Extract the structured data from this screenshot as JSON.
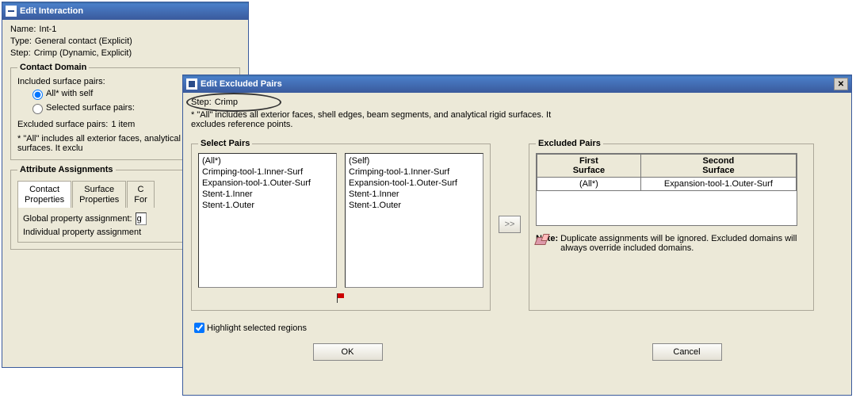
{
  "w1": {
    "title": "Edit Interaction",
    "nameLbl": "Name:",
    "nameVal": "Int-1",
    "typeLbl": "Type:",
    "typeVal": "General contact (Explicit)",
    "stepLbl": "Step:",
    "stepVal": "Crimp (Dynamic, Explicit)",
    "domainLegend": "Contact Domain",
    "includedLbl": "Included surface pairs:",
    "radioAll": "All* with self",
    "radioSel": "Selected surface pairs:",
    "excludedLbl": "Excluded surface pairs:",
    "excludedVal": "1 item",
    "note": "* \"All\" includes all exterior faces, analytical rigid surfaces. It exclu",
    "attrLegend": "Attribute Assignments",
    "tab1a": "Contact",
    "tab1b": "Properties",
    "tab2a": "Surface",
    "tab2b": "Properties",
    "tab3a": "C",
    "tab3b": "For",
    "globLbl": "Global property assignment:",
    "globVal": "g",
    "indivLbl": "Individual property assignment"
  },
  "w2": {
    "title": "Edit Excluded Pairs",
    "stepLbl": "Step:",
    "stepVal": "Crimp",
    "note": "* \"All\" includes all exterior faces, shell edges, beam segments, and analytical rigid surfaces. It excludes reference points.",
    "selLegend": "Select Pairs",
    "list1": [
      "(All*)",
      "Crimping-tool-1.Inner-Surf",
      "Expansion-tool-1.Outer-Surf",
      "Stent-1.Inner",
      "Stent-1.Outer"
    ],
    "list2": [
      "(Self)",
      "Crimping-tool-1.Inner-Surf",
      "Expansion-tool-1.Outer-Surf",
      "Stent-1.Inner",
      "Stent-1.Outer"
    ],
    "arrow": ">>",
    "exclLegend": "Excluded Pairs",
    "th1a": "First",
    "th1b": "Surface",
    "th2a": "Second",
    "th2b": "Surface",
    "td1": "(All*)",
    "td2": "Expansion-tool-1.Outer-Surf",
    "noteLbl": "Note:",
    "noteTxt": "Duplicate assignments will be ignored. Excluded domains will always override included domains.",
    "highlight": "Highlight selected regions",
    "ok": "OK",
    "cancel": "Cancel"
  }
}
